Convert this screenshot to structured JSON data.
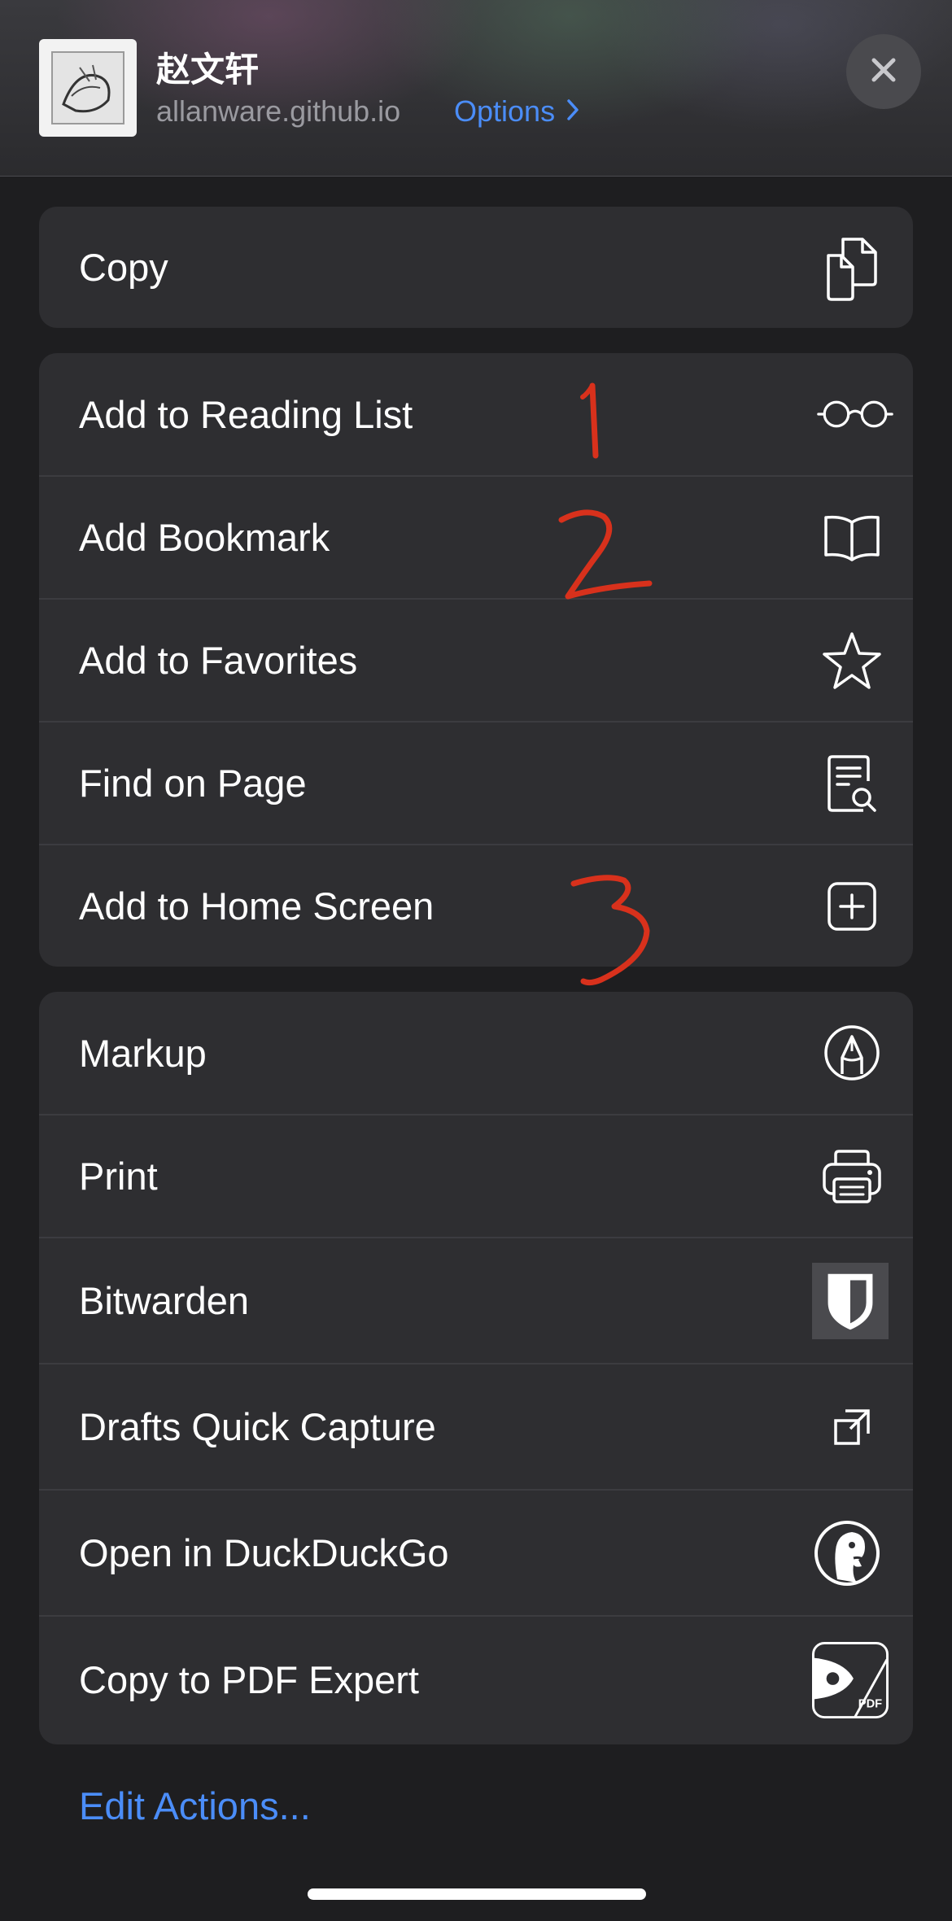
{
  "header": {
    "title": "赵文轩",
    "url": "allanware.github.io",
    "options_label": "Options"
  },
  "copy_group": [
    {
      "label": "Copy",
      "icon": "copy-icon"
    }
  ],
  "page_actions": [
    {
      "label": "Add to Reading List",
      "icon": "glasses-icon"
    },
    {
      "label": "Add Bookmark",
      "icon": "book-icon"
    },
    {
      "label": "Add to Favorites",
      "icon": "star-icon"
    },
    {
      "label": "Find on Page",
      "icon": "find-document-icon"
    },
    {
      "label": "Add to Home Screen",
      "icon": "plus-square-icon"
    }
  ],
  "app_actions": [
    {
      "label": "Markup",
      "icon": "markup-pen-icon"
    },
    {
      "label": "Print",
      "icon": "printer-icon"
    },
    {
      "label": "Bitwarden",
      "icon": "bitwarden-shield-icon"
    },
    {
      "label": "Drafts Quick Capture",
      "icon": "drafts-icon"
    },
    {
      "label": "Open in DuckDuckGo",
      "icon": "duckduckgo-icon"
    },
    {
      "label": "Copy to PDF Expert",
      "icon": "pdf-expert-icon",
      "icon_text": "PDF"
    }
  ],
  "footer": {
    "edit_actions_label": "Edit Actions..."
  },
  "annotations": [
    "1",
    "2",
    "3"
  ],
  "colors": {
    "accent": "#4b8df8",
    "background": "#1e1e20",
    "row_background": "#2e2e31",
    "annotation": "#d8311c"
  }
}
